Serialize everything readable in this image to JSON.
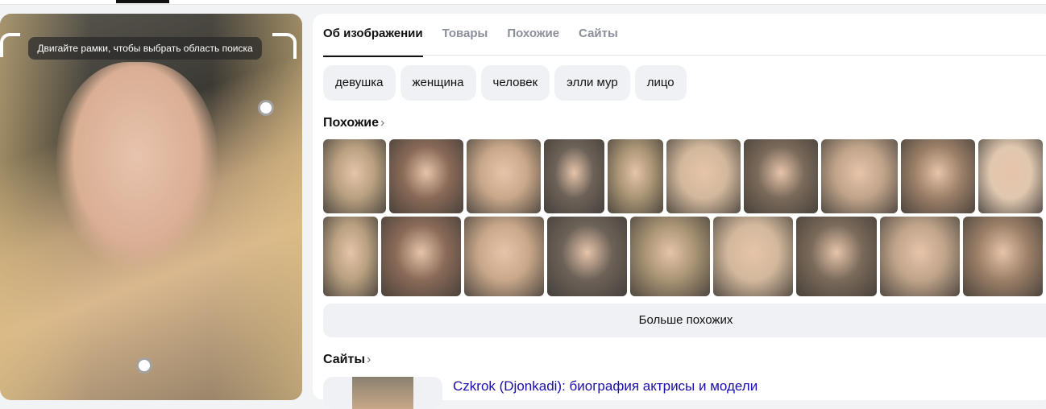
{
  "viewer": {
    "hint": "Двигайте рамки, чтобы выбрать область поиска"
  },
  "tabs": [
    {
      "label": "Об изображении"
    },
    {
      "label": "Товары"
    },
    {
      "label": "Похожие"
    },
    {
      "label": "Сайты"
    }
  ],
  "tags": [
    {
      "label": "девушка"
    },
    {
      "label": "женщина"
    },
    {
      "label": "человек"
    },
    {
      "label": "элли мур"
    },
    {
      "label": "лицо"
    }
  ],
  "similar": {
    "title": "Похожие",
    "chevron": "›",
    "more": "Больше похожих"
  },
  "sites": {
    "title": "Сайты",
    "chevron": "›",
    "items": [
      {
        "title": "Czkrok (Djonkadi): биография актрисы и модели"
      }
    ]
  }
}
